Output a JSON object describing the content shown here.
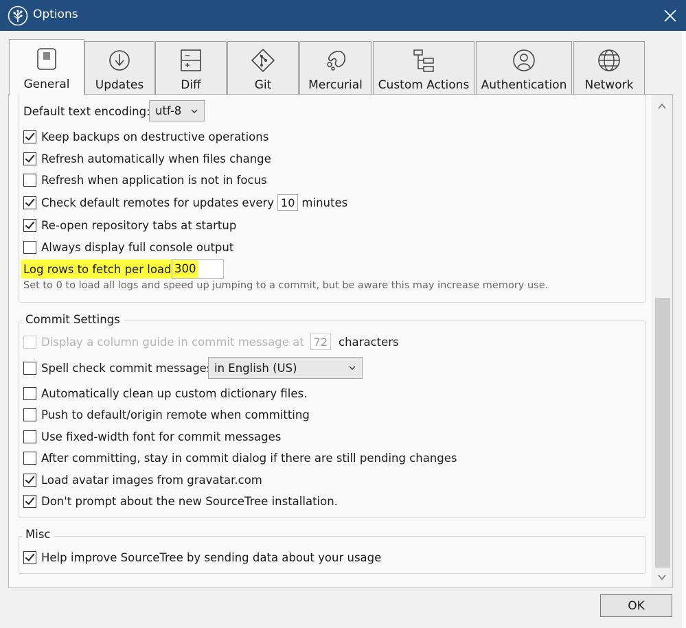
{
  "window": {
    "title": "Options",
    "close_icon": "close-icon",
    "app_icon": "sourcetree-logo-icon"
  },
  "tabs": [
    {
      "label": "General",
      "icon": "general-switch-icon",
      "selected": true
    },
    {
      "label": "Updates",
      "icon": "download-circle-icon",
      "selected": false
    },
    {
      "label": "Diff",
      "icon": "diff-icon",
      "selected": false
    },
    {
      "label": "Git",
      "icon": "git-icon",
      "selected": false
    },
    {
      "label": "Mercurial",
      "icon": "mercurial-icon",
      "selected": false
    },
    {
      "label": "Custom Actions",
      "icon": "custom-actions-icon",
      "selected": false
    },
    {
      "label": "Authentication",
      "icon": "user-circle-icon",
      "selected": false
    },
    {
      "label": "Network",
      "icon": "globe-icon",
      "selected": false
    }
  ],
  "general": {
    "encoding_label": "Default text encoding:",
    "encoding_value": "utf-8",
    "options": [
      {
        "label": "Keep backups on destructive operations",
        "checked": true
      },
      {
        "label": "Refresh automatically when files change",
        "checked": true
      },
      {
        "label": "Refresh when application is not in focus",
        "checked": false
      },
      {
        "label": "Check default remotes for updates every",
        "checked": true,
        "value": "10",
        "suffix": "minutes"
      },
      {
        "label": "Re-open repository tabs at startup",
        "checked": true
      },
      {
        "label": "Always display full console output",
        "checked": false
      }
    ],
    "log_rows_label": "Log rows to fetch per load:",
    "log_rows_value": "300",
    "log_rows_hint": "Set to 0 to load all logs and speed up jumping to a commit, but be aware this may increase memory use."
  },
  "commit_settings": {
    "title": "Commit Settings",
    "column_guide": {
      "label": "Display a column guide in commit message at",
      "value": "72",
      "suffix": "characters",
      "checked": false,
      "disabled": true
    },
    "spell_check": {
      "label": "Spell check commit messages",
      "checked": false,
      "language": "in English (US)"
    },
    "options": [
      {
        "label": "Automatically clean up custom dictionary files.",
        "checked": false
      },
      {
        "label": "Push to default/origin remote when committing",
        "checked": false
      },
      {
        "label": "Use fixed-width font for commit messages",
        "checked": false
      },
      {
        "label": "After committing, stay in commit dialog if there are still pending changes",
        "checked": false
      },
      {
        "label": "Load avatar images from gravatar.com",
        "checked": true
      },
      {
        "label": "Don't prompt about the new SourceTree installation.",
        "checked": true
      }
    ]
  },
  "misc": {
    "title": "Misc",
    "options": [
      {
        "label": "Help improve SourceTree by sending data about your usage",
        "checked": true
      }
    ]
  },
  "buttons": {
    "ok": "OK"
  },
  "colors": {
    "titlebar": "#224e7f",
    "highlight": "#ffff3f"
  }
}
